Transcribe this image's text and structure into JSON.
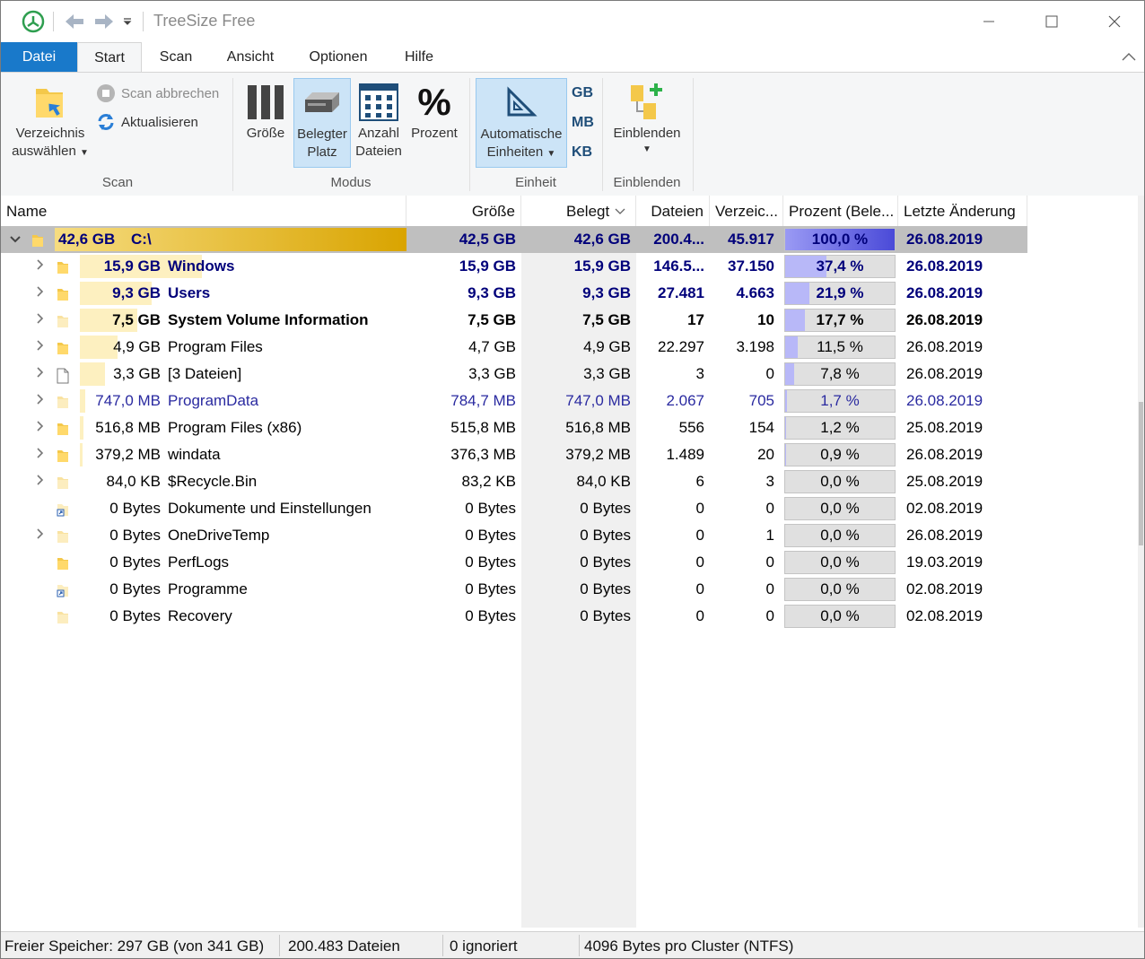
{
  "window": {
    "title": "TreeSize Free",
    "colors": {
      "file_tab": "#1979ca",
      "root_row": "#bfbfbf",
      "pct_fill": "#b8b8f8",
      "size_bar": "#fdf0c0"
    }
  },
  "tabs": [
    {
      "label": "Datei"
    },
    {
      "label": "Start"
    },
    {
      "label": "Scan"
    },
    {
      "label": "Ansicht"
    },
    {
      "label": "Optionen"
    },
    {
      "label": "Hilfe"
    }
  ],
  "ribbon": {
    "scan": {
      "select_dir_line1": "Verzeichnis",
      "select_dir_line2": "auswählen",
      "cancel": "Scan abbrechen",
      "refresh": "Aktualisieren",
      "group": "Scan"
    },
    "modus": {
      "groesse": "Größe",
      "belegt_line1": "Belegter",
      "belegt_line2": "Platz",
      "anzahl_line1": "Anzahl",
      "anzahl_line2": "Dateien",
      "prozent": "Prozent",
      "group": "Modus"
    },
    "einheit": {
      "auto_line1": "Automatische",
      "auto_line2": "Einheiten",
      "gb": "GB",
      "mb": "MB",
      "kb": "KB",
      "group": "Einheit"
    },
    "einblenden": {
      "button": "Einblenden",
      "group": "Einblenden"
    }
  },
  "columns": {
    "name": "Name",
    "groesse": "Größe",
    "belegt": "Belegt",
    "dateien": "Dateien",
    "verzeichnisse": "Verzeic...",
    "prozent": "Prozent (Bele...",
    "aenderung": "Letzte Änderung"
  },
  "rows": [
    {
      "bar": "42,6 GB",
      "name": "C:\\",
      "size": "42,5 GB",
      "alloc": "42,6 GB",
      "files": "200.4...",
      "dirs": "45.917",
      "pct": "100,0 %",
      "pct_value": 100,
      "date": "26.08.2019",
      "bar_fraction": 1.0
    },
    {
      "bar": "15,9 GB",
      "name": "Windows",
      "size": "15,9 GB",
      "alloc": "15,9 GB",
      "files": "146.5...",
      "dirs": "37.150",
      "pct": "37,4 %",
      "pct_value": 37.4,
      "date": "26.08.2019",
      "bar_fraction": 0.374
    },
    {
      "bar": "9,3 GB",
      "name": "Users",
      "size": "9,3 GB",
      "alloc": "9,3 GB",
      "files": "27.481",
      "dirs": "4.663",
      "pct": "21,9 %",
      "pct_value": 21.9,
      "date": "26.08.2019",
      "bar_fraction": 0.219
    },
    {
      "bar": "7,5 GB",
      "name": "System Volume Information",
      "size": "7,5 GB",
      "alloc": "7,5 GB",
      "files": "17",
      "dirs": "10",
      "pct": "17,7 %",
      "pct_value": 17.7,
      "date": "26.08.2019",
      "bar_fraction": 0.177
    },
    {
      "bar": "4,9 GB",
      "name": "Program Files",
      "size": "4,7 GB",
      "alloc": "4,9 GB",
      "files": "22.297",
      "dirs": "3.198",
      "pct": "11,5 %",
      "pct_value": 11.5,
      "date": "26.08.2019",
      "bar_fraction": 0.115
    },
    {
      "bar": "3,3 GB",
      "name": "[3 Dateien]",
      "size": "3,3 GB",
      "alloc": "3,3 GB",
      "files": "3",
      "dirs": "0",
      "pct": "7,8 %",
      "pct_value": 7.8,
      "date": "26.08.2019",
      "bar_fraction": 0.078
    },
    {
      "bar": "747,0 MB",
      "name": "ProgramData",
      "size": "784,7 MB",
      "alloc": "747,0 MB",
      "files": "2.067",
      "dirs": "705",
      "pct": "1,7 %",
      "pct_value": 1.7,
      "date": "26.08.2019",
      "bar_fraction": 0.017
    },
    {
      "bar": "516,8 MB",
      "name": "Program Files (x86)",
      "size": "515,8 MB",
      "alloc": "516,8 MB",
      "files": "556",
      "dirs": "154",
      "pct": "1,2 %",
      "pct_value": 1.2,
      "date": "25.08.2019",
      "bar_fraction": 0.012
    },
    {
      "bar": "379,2 MB",
      "name": "windata",
      "size": "376,3 MB",
      "alloc": "379,2 MB",
      "files": "1.489",
      "dirs": "20",
      "pct": "0,9 %",
      "pct_value": 0.9,
      "date": "26.08.2019",
      "bar_fraction": 0.009
    },
    {
      "bar": "84,0 KB",
      "name": "$Recycle.Bin",
      "size": "83,2 KB",
      "alloc": "84,0 KB",
      "files": "6",
      "dirs": "3",
      "pct": "0,0 %",
      "pct_value": 0,
      "date": "25.08.2019",
      "bar_fraction": 0
    },
    {
      "bar": "0 Bytes",
      "name": "Dokumente und Einstellungen",
      "size": "0 Bytes",
      "alloc": "0 Bytes",
      "files": "0",
      "dirs": "0",
      "pct": "0,0 %",
      "pct_value": 0,
      "date": "02.08.2019",
      "bar_fraction": 0
    },
    {
      "bar": "0 Bytes",
      "name": "OneDriveTemp",
      "size": "0 Bytes",
      "alloc": "0 Bytes",
      "files": "0",
      "dirs": "1",
      "pct": "0,0 %",
      "pct_value": 0,
      "date": "26.08.2019",
      "bar_fraction": 0
    },
    {
      "bar": "0 Bytes",
      "name": "PerfLogs",
      "size": "0 Bytes",
      "alloc": "0 Bytes",
      "files": "0",
      "dirs": "0",
      "pct": "0,0 %",
      "pct_value": 0,
      "date": "19.03.2019",
      "bar_fraction": 0
    },
    {
      "bar": "0 Bytes",
      "name": "Programme",
      "size": "0 Bytes",
      "alloc": "0 Bytes",
      "files": "0",
      "dirs": "0",
      "pct": "0,0 %",
      "pct_value": 0,
      "date": "02.08.2019",
      "bar_fraction": 0
    },
    {
      "bar": "0 Bytes",
      "name": "Recovery",
      "size": "0 Bytes",
      "alloc": "0 Bytes",
      "files": "0",
      "dirs": "0",
      "pct": "0,0 %",
      "pct_value": 0,
      "date": "02.08.2019",
      "bar_fraction": 0
    }
  ],
  "status": {
    "free": "Freier Speicher: 297 GB  (von 341 GB)",
    "files": "200.483  Dateien",
    "ignored": "0 ignoriert",
    "cluster": "4096  Bytes pro Cluster (NTFS)"
  }
}
